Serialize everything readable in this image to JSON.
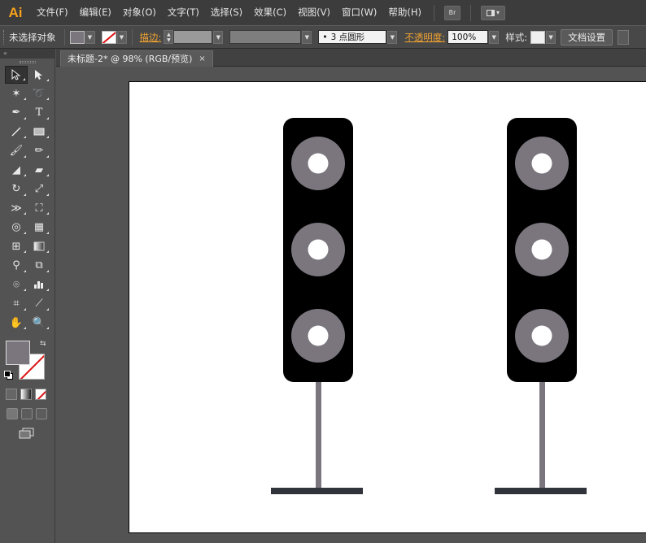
{
  "app": {
    "logo": "Ai"
  },
  "menu": {
    "items": [
      "文件(F)",
      "编辑(E)",
      "对象(O)",
      "文字(T)",
      "选择(S)",
      "效果(C)",
      "视图(V)",
      "窗口(W)",
      "帮助(H)"
    ],
    "bridge_label": "Br",
    "arrange_label": "▾"
  },
  "controlbar": {
    "selection_status": "未选择对象",
    "stroke_label": "描边:",
    "brush_label": "3 点圆形",
    "opacity_label": "不透明度:",
    "opacity_value": "100%",
    "style_label": "样式:",
    "doc_setup_label": "文档设置",
    "fill_color": "#7b767e",
    "stroke_none": true
  },
  "document": {
    "tab_title": "未标题-2* @ 98% (RGB/预览)",
    "close_glyph": "×"
  },
  "toolbar": {
    "fill_color": "#7b767e",
    "stroke_color": "none"
  },
  "artwork": {
    "speaker_body_color": "#000000",
    "cone_color": "#7b767e",
    "dust_cap_color": "#ffffff",
    "pole_color": "#7b767e",
    "base_color": "#30343a",
    "speakers": 2,
    "cones_per_speaker": 3
  }
}
